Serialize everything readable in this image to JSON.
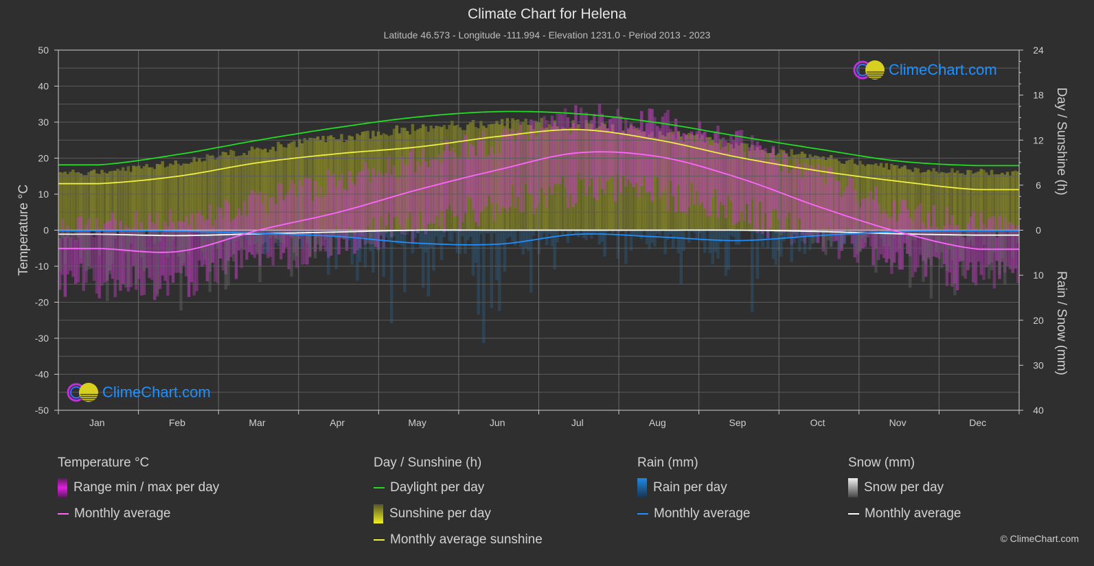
{
  "header": {
    "title": "Climate Chart for Helena",
    "subtitle": "Latitude 46.573 - Longitude -111.994 - Elevation 1231.0 - Period 2013 - 2023"
  },
  "axes": {
    "left_title": "Temperature °C",
    "right_top_title": "Day / Sunshine (h)",
    "right_bottom_title": "Rain / Snow (mm)"
  },
  "logo": {
    "text": "ClimeChart.com"
  },
  "copyright": "© ClimeChart.com",
  "legend": {
    "groups": [
      {
        "title": "Temperature °C",
        "items": [
          {
            "label": "Range min / max per day",
            "kind": "bar",
            "color": "#e020e0"
          },
          {
            "label": "Monthly average",
            "kind": "line",
            "color": "#ff66ff"
          }
        ]
      },
      {
        "title": "Day / Sunshine (h)",
        "items": [
          {
            "label": "Daylight per day",
            "kind": "line",
            "color": "#22dd22"
          },
          {
            "label": "Sunshine per day",
            "kind": "bar",
            "color": "#e6e622"
          },
          {
            "label": "Monthly average sunshine",
            "kind": "line",
            "color": "#f0f040"
          }
        ]
      },
      {
        "title": "Rain (mm)",
        "items": [
          {
            "label": "Rain per day",
            "kind": "bar",
            "color": "#1e88e5"
          },
          {
            "label": "Monthly average",
            "kind": "line",
            "color": "#1e90ff"
          }
        ]
      },
      {
        "title": "Snow (mm)",
        "items": [
          {
            "label": "Snow per day",
            "kind": "bar",
            "color": "#e0e0e0"
          },
          {
            "label": "Monthly average",
            "kind": "line",
            "color": "#ffffff"
          }
        ]
      }
    ]
  },
  "chart_data": {
    "type": "line",
    "title": "Climate Chart for Helena",
    "subtitle": "Latitude 46.573 - Longitude -111.994 - Elevation 1231.0 - Period 2013 - 2023",
    "categories": [
      "Jan",
      "Feb",
      "Mar",
      "Apr",
      "May",
      "Jun",
      "Jul",
      "Aug",
      "Sep",
      "Oct",
      "Nov",
      "Dec"
    ],
    "xlabel": "",
    "ylabel_left": "Temperature °C",
    "ylabel_right_top": "Day / Sunshine (h)",
    "ylabel_right_bottom": "Rain / Snow (mm)",
    "y_left": {
      "range": [
        -50,
        50
      ],
      "ticks": [
        50,
        40,
        30,
        20,
        10,
        0,
        -10,
        -20,
        -30,
        -40,
        -50
      ]
    },
    "y_right_top": {
      "range": [
        0,
        24
      ],
      "ticks": [
        24,
        18,
        12,
        6,
        0
      ]
    },
    "y_right_bottom": {
      "range": [
        0,
        40
      ],
      "ticks": [
        0,
        10,
        20,
        30,
        40
      ]
    },
    "grid": true,
    "series": [
      {
        "name": "Temperature monthly average",
        "axis": "left",
        "color": "#ff66ff",
        "values": [
          -5.1,
          -5.9,
          0.0,
          5.0,
          11.3,
          16.8,
          21.5,
          20.4,
          14.5,
          6.5,
          -0.5,
          -5.3
        ]
      },
      {
        "name": "Daylight per day",
        "axis": "right_top",
        "color": "#22dd22",
        "values": [
          8.7,
          10.1,
          12.0,
          13.7,
          15.1,
          15.8,
          15.5,
          14.3,
          12.5,
          10.8,
          9.2,
          8.6
        ]
      },
      {
        "name": "Monthly average sunshine",
        "axis": "right_top",
        "color": "#f0f040",
        "values": [
          6.2,
          7.2,
          9.0,
          10.2,
          11.1,
          12.5,
          13.4,
          12.0,
          9.7,
          7.9,
          6.5,
          5.4
        ]
      },
      {
        "name": "Rain monthly average",
        "axis": "right_bottom",
        "color": "#1e90ff",
        "values": [
          0.1,
          0.2,
          0.7,
          1.4,
          2.9,
          3.1,
          0.9,
          1.5,
          2.3,
          1.2,
          0.3,
          0.1
        ]
      },
      {
        "name": "Snow monthly average",
        "axis": "right_bottom",
        "color": "#ffffff",
        "values": [
          0.9,
          1.2,
          0.8,
          0.4,
          0.0,
          0.0,
          0.0,
          0.0,
          0.0,
          0.3,
          0.8,
          1.1
        ]
      }
    ],
    "temperature_range_band": {
      "name": "Range min / max per day",
      "approx_monthly_max": [
        1,
        3,
        8,
        14,
        20,
        25,
        31,
        30,
        24,
        15,
        6,
        1
      ],
      "approx_monthly_min": [
        -14,
        -14,
        -8,
        -3,
        2,
        7,
        11,
        10,
        5,
        -2,
        -8,
        -13
      ]
    }
  }
}
